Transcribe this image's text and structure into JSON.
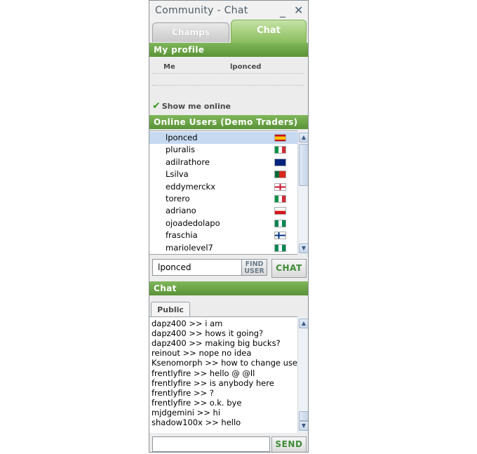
{
  "window": {
    "title": "Community - Chat",
    "minimize_glyph": "_",
    "close_glyph": "✕"
  },
  "tabs": [
    {
      "label": "Champs"
    },
    {
      "label": "Chat"
    }
  ],
  "profile": {
    "header": "My profile",
    "key": "Me",
    "value": "lponced",
    "show_online_label": "Show me online",
    "show_online_checked": true
  },
  "users": {
    "header": "Online Users (Demo Traders)",
    "items": [
      {
        "name": "lponced",
        "flag": "spain-flag"
      },
      {
        "name": "pluralis",
        "flag": "italy-flag"
      },
      {
        "name": "adilrathore",
        "flag": "australia-flag"
      },
      {
        "name": "Lsilva",
        "flag": "portugal-flag"
      },
      {
        "name": "eddymerckx",
        "flag": "uk-flag"
      },
      {
        "name": "torero",
        "flag": "italy-flag"
      },
      {
        "name": "adriano",
        "flag": "czech-flag"
      },
      {
        "name": "ojoadedolapo",
        "flag": "nigeria-flag"
      },
      {
        "name": "fraschia",
        "flag": "finland-flag"
      },
      {
        "name": "mariolevel7",
        "flag": "nigeria-flag"
      }
    ],
    "selected_index": 0,
    "search_value": "lponced",
    "find_label_line1": "FIND",
    "find_label_line2": "USER",
    "chat_button_label": "CHAT"
  },
  "chat": {
    "header": "Chat",
    "active_tab": "Public",
    "messages": [
      "dapz400 >> i am",
      "dapz400 >> hows it going?",
      "dapz400 >> making big bucks?",
      "reinout >> nope no idea",
      "Ksenomorph >> how to change user?",
      "frentlyfire >> hello @ @ll",
      "frentlyfire >> is anybody here",
      "frentlyfire >> ?",
      "frentlyfire >> o.k. bye",
      "mjdgemini >> hi",
      "shadow100x >> hello"
    ],
    "message_input_value": "",
    "send_button_label": "SEND"
  },
  "colors": {
    "accent_green": "#6aa346",
    "selection_blue": "#c5d9f1",
    "button_text_green": "#3d8a35"
  }
}
